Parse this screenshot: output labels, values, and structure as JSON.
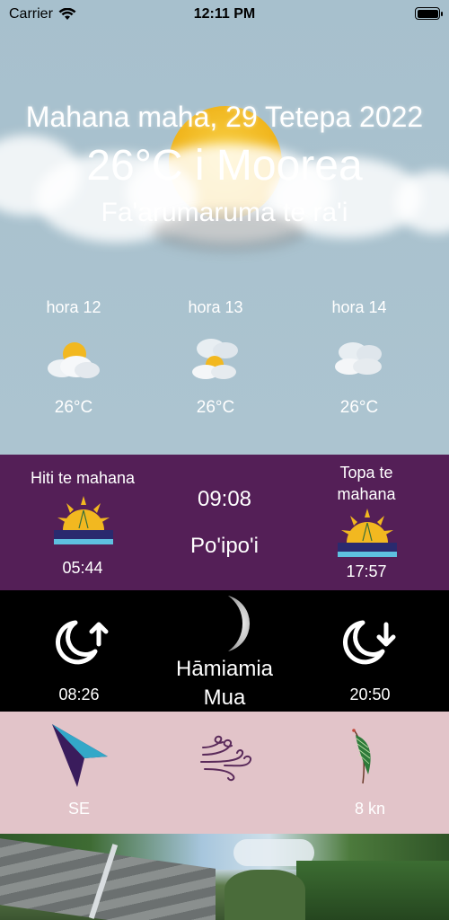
{
  "status_bar": {
    "carrier": "Carrier",
    "time": "12:11 PM"
  },
  "hero": {
    "date": "Mahana maha, 29 Tetepa 2022",
    "temp_location": "26°C i Moorea",
    "condition": "Fa'arumaruma te ra'i"
  },
  "forecast": [
    {
      "hour": "hora 12",
      "temp": "26°C",
      "icon": "sun-behind-cloud-icon"
    },
    {
      "hour": "hora 13",
      "temp": "26°C",
      "icon": "cloud-sun-icon"
    },
    {
      "hour": "hora 14",
      "temp": "26°C",
      "icon": "cloud-icon"
    }
  ],
  "sun": {
    "sunrise_label": "Hiti te mahana",
    "sunrise_time": "05:44",
    "current_time": "09:08",
    "period": "Po'ipo'i",
    "sunset_label": "Topa te mahana",
    "sunset_time": "17:57"
  },
  "moon": {
    "moonrise_time": "08:26",
    "phase": "Hāmiamia Mua",
    "moonset_time": "20:50"
  },
  "wind": {
    "direction": "SE",
    "speed": "8 kn"
  },
  "colors": {
    "sky": "#a9c1cd",
    "sun_panel": "#541f57",
    "moon_panel": "#000000",
    "wind_panel": "#e2c4c9",
    "arrow": "#3a1c5c",
    "arrow_accent": "#33a8c8"
  }
}
